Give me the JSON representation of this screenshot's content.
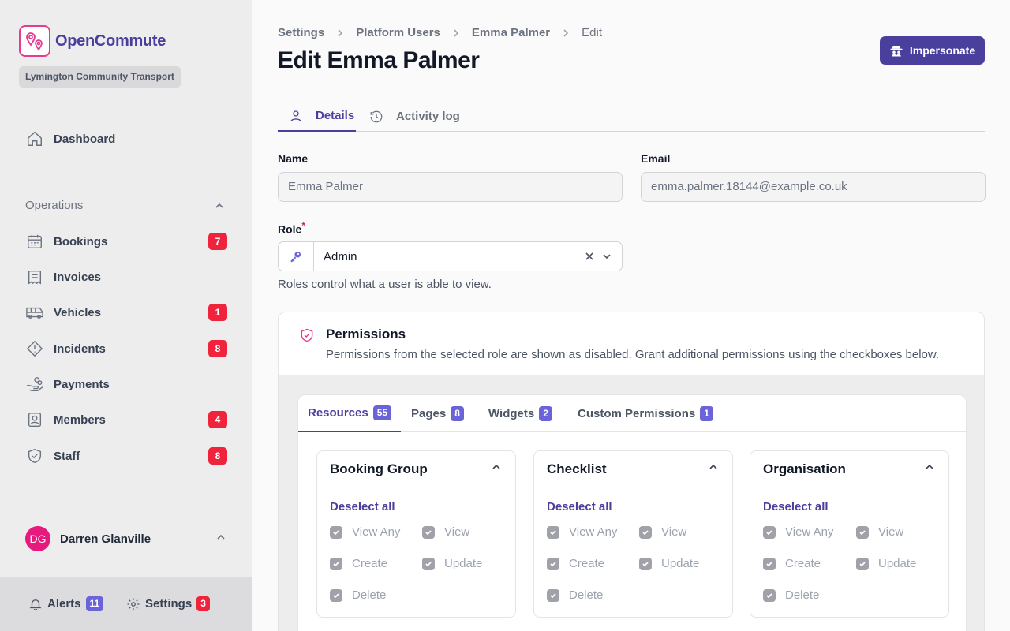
{
  "app": {
    "name": "OpenCommute",
    "org": "Lymington Community Transport"
  },
  "sidebar": {
    "dashboard": {
      "label": "Dashboard"
    },
    "group": {
      "label": "Operations"
    },
    "items": [
      {
        "label": "Bookings",
        "badge": "7",
        "icon": "calendar-icon"
      },
      {
        "label": "Invoices",
        "badge": "",
        "icon": "receipt-icon"
      },
      {
        "label": "Vehicles",
        "badge": "1",
        "icon": "bus-icon"
      },
      {
        "label": "Incidents",
        "badge": "8",
        "icon": "alert-diamond-icon"
      },
      {
        "label": "Payments",
        "badge": "",
        "icon": "hand-coins-icon"
      },
      {
        "label": "Members",
        "badge": "4",
        "icon": "id-badge-icon"
      },
      {
        "label": "Staff",
        "badge": "8",
        "icon": "shield-check-icon"
      }
    ],
    "user": {
      "initials": "DG",
      "name": "Darren Glanville"
    },
    "footer": {
      "alerts": {
        "label": "Alerts",
        "count": "11"
      },
      "settings": {
        "label": "Settings",
        "count": "3"
      }
    }
  },
  "breadcrumb": [
    "Settings",
    "Platform Users",
    "Emma Palmer",
    "Edit"
  ],
  "header": {
    "title": "Edit Emma Palmer",
    "impersonate_label": "Impersonate"
  },
  "tabs": [
    {
      "label": "Details"
    },
    {
      "label": "Activity log"
    }
  ],
  "form": {
    "name": {
      "label": "Name",
      "value": "Emma Palmer"
    },
    "email": {
      "label": "Email",
      "value": "emma.palmer.18144@example.co.uk"
    },
    "role": {
      "label": "Role",
      "required_mark": "*",
      "value": "Admin",
      "helper": "Roles control what a user is able to view."
    }
  },
  "permissions": {
    "title": "Permissions",
    "description": "Permissions from the selected role are shown as disabled. Grant additional permissions using the checkboxes below.",
    "tabs": [
      {
        "label": "Resources",
        "count": "55"
      },
      {
        "label": "Pages",
        "count": "8"
      },
      {
        "label": "Widgets",
        "count": "2"
      },
      {
        "label": "Custom Permissions",
        "count": "1"
      }
    ],
    "deselect_label": "Deselect all",
    "cards": [
      {
        "title": "Booking Group",
        "perms": [
          "View Any",
          "View",
          "Create",
          "Update",
          "Delete"
        ]
      },
      {
        "title": "Checklist",
        "perms": [
          "View Any",
          "View",
          "Create",
          "Update",
          "Delete"
        ]
      },
      {
        "title": "Organisation",
        "perms": [
          "View Any",
          "View",
          "Create",
          "Update",
          "Delete"
        ]
      }
    ]
  },
  "colors": {
    "brand": "#4b3f9e",
    "accent": "#e63b8f",
    "badge": "#ef233c",
    "count": "#6b63d8"
  }
}
